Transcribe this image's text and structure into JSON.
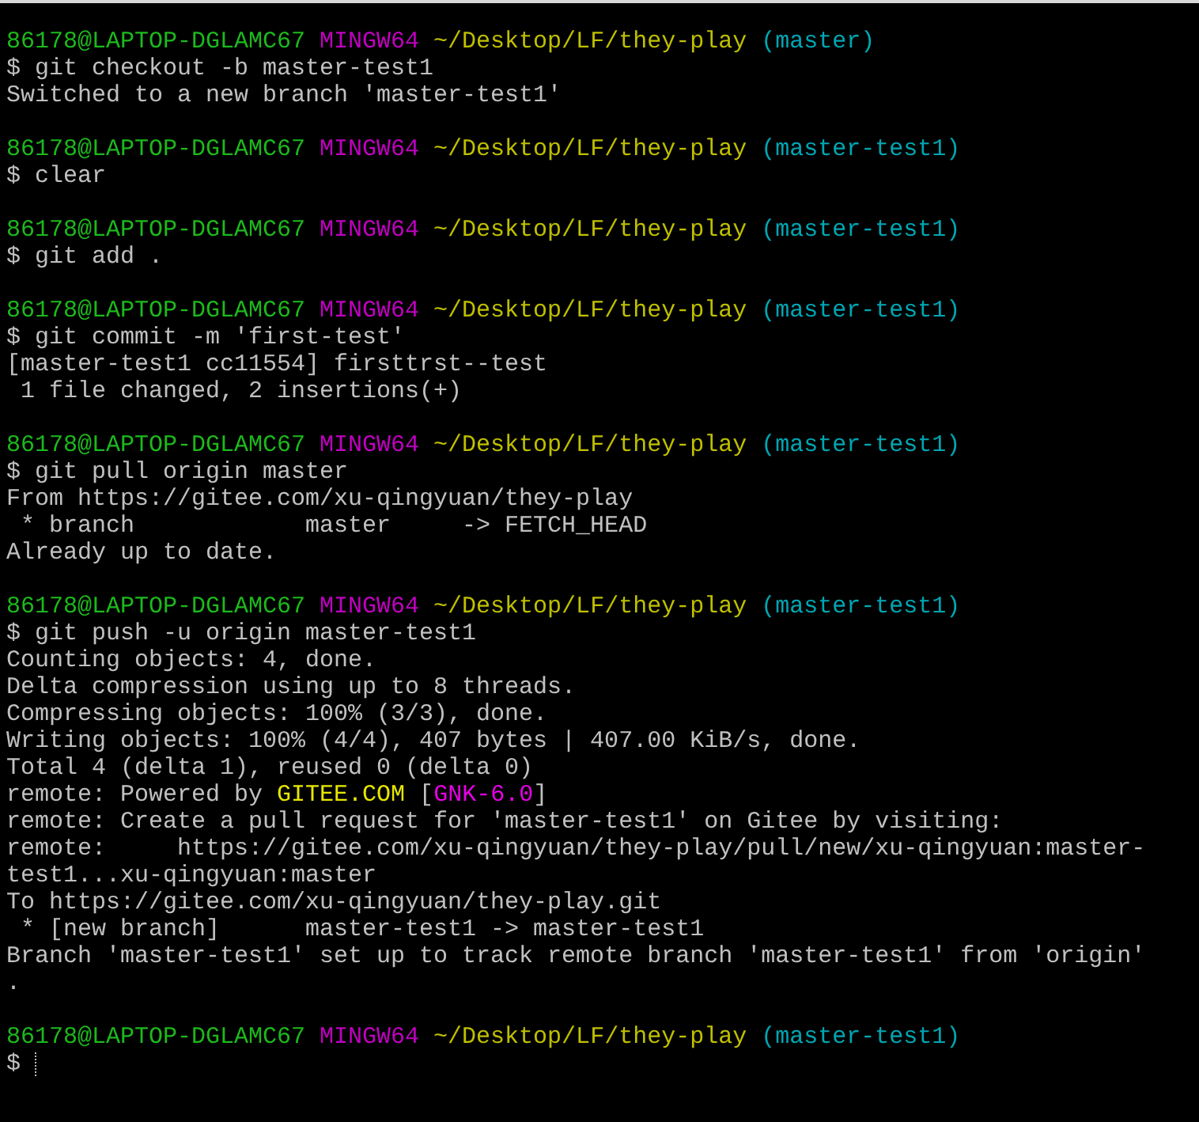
{
  "lines": [
    {
      "kind": "prompt",
      "user": "86178@LAPTOP-DGLAMC67",
      "shell": "MINGW64",
      "path": "~/Desktop/LF/they-play",
      "branch": "(master)"
    },
    {
      "kind": "output",
      "text": "$ git checkout -b master-test1"
    },
    {
      "kind": "output",
      "text": "Switched to a new branch 'master-test1'"
    },
    {
      "kind": "blank"
    },
    {
      "kind": "prompt",
      "user": "86178@LAPTOP-DGLAMC67",
      "shell": "MINGW64",
      "path": "~/Desktop/LF/they-play",
      "branch": "(master-test1)"
    },
    {
      "kind": "output",
      "text": "$ clear"
    },
    {
      "kind": "blank"
    },
    {
      "kind": "prompt",
      "user": "86178@LAPTOP-DGLAMC67",
      "shell": "MINGW64",
      "path": "~/Desktop/LF/they-play",
      "branch": "(master-test1)"
    },
    {
      "kind": "output",
      "text": "$ git add ."
    },
    {
      "kind": "blank"
    },
    {
      "kind": "prompt",
      "user": "86178@LAPTOP-DGLAMC67",
      "shell": "MINGW64",
      "path": "~/Desktop/LF/they-play",
      "branch": "(master-test1)"
    },
    {
      "kind": "output",
      "text": "$ git commit -m 'first-test'"
    },
    {
      "kind": "output",
      "text": "[master-test1 cc11554] firsttrst--test"
    },
    {
      "kind": "output",
      "text": " 1 file changed, 2 insertions(+)"
    },
    {
      "kind": "blank"
    },
    {
      "kind": "prompt",
      "user": "86178@LAPTOP-DGLAMC67",
      "shell": "MINGW64",
      "path": "~/Desktop/LF/they-play",
      "branch": "(master-test1)"
    },
    {
      "kind": "output",
      "text": "$ git pull origin master"
    },
    {
      "kind": "output",
      "text": "From https://gitee.com/xu-qingyuan/they-play"
    },
    {
      "kind": "output",
      "text": " * branch            master     -> FETCH_HEAD"
    },
    {
      "kind": "output",
      "text": "Already up to date."
    },
    {
      "kind": "blank"
    },
    {
      "kind": "prompt",
      "user": "86178@LAPTOP-DGLAMC67",
      "shell": "MINGW64",
      "path": "~/Desktop/LF/they-play",
      "branch": "(master-test1)"
    },
    {
      "kind": "output",
      "text": "$ git push -u origin master-test1"
    },
    {
      "kind": "output",
      "text": "Counting objects: 4, done."
    },
    {
      "kind": "output",
      "text": "Delta compression using up to 8 threads."
    },
    {
      "kind": "output",
      "text": "Compressing objects: 100% (3/3), done."
    },
    {
      "kind": "output",
      "text": "Writing objects: 100% (4/4), 407 bytes | 407.00 KiB/s, done."
    },
    {
      "kind": "output",
      "text": "Total 4 (delta 1), reused 0 (delta 0)"
    },
    {
      "kind": "mixed",
      "parts": [
        {
          "kind": "plain",
          "text": "remote: Powered by "
        },
        {
          "kind": "yellow",
          "text": "GITEE.COM"
        },
        {
          "kind": "plain",
          "text": " ["
        },
        {
          "kind": "magenta",
          "text": "GNK-6.0"
        },
        {
          "kind": "plain",
          "text": "]"
        }
      ]
    },
    {
      "kind": "output",
      "text": "remote: Create a pull request for 'master-test1' on Gitee by visiting:"
    },
    {
      "kind": "output",
      "text": "remote:     https://gitee.com/xu-qingyuan/they-play/pull/new/xu-qingyuan:master-"
    },
    {
      "kind": "output",
      "text": "test1...xu-qingyuan:master"
    },
    {
      "kind": "output",
      "text": "To https://gitee.com/xu-qingyuan/they-play.git"
    },
    {
      "kind": "output",
      "text": " * [new branch]      master-test1 -> master-test1"
    },
    {
      "kind": "output",
      "text": "Branch 'master-test1' set up to track remote branch 'master-test1' from 'origin'"
    },
    {
      "kind": "output",
      "text": "."
    },
    {
      "kind": "blank"
    },
    {
      "kind": "prompt",
      "user": "86178@LAPTOP-DGLAMC67",
      "shell": "MINGW64",
      "path": "~/Desktop/LF/they-play",
      "branch": "(master-test1)"
    },
    {
      "kind": "input",
      "symbol": "$"
    }
  ]
}
